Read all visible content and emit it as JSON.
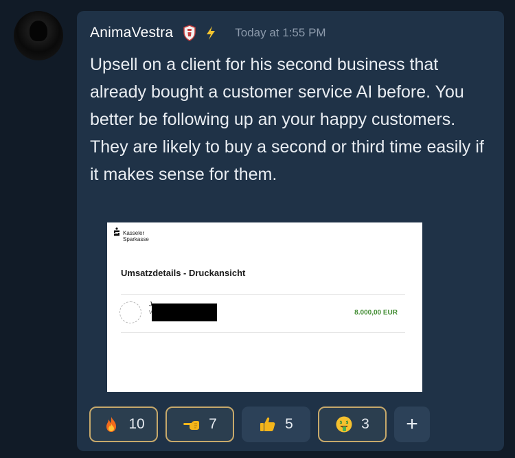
{
  "author": {
    "username": "AnimaVestra",
    "avatar_icon": "statue-avatar",
    "badges": [
      "shield-icon",
      "lightning-icon"
    ]
  },
  "message": {
    "timestamp": "Today at 1:55 PM",
    "text": "Upsell on a client for his second business that already bought a customer service AI before. You better be following up an your happy customers. They are likely to buy a second or third time easily if it makes sense for them."
  },
  "attachment": {
    "bank_name_line1": "Kasseler",
    "bank_name_line2": "Sparkasse",
    "doc_title": "Umsatzdetails - Druckansicht",
    "tx_initial": "J",
    "tx_sub_initial": "V",
    "amount": "8.000,00 EUR"
  },
  "reactions": [
    {
      "emoji": "fire-icon",
      "count": "10",
      "active": true
    },
    {
      "emoji": "pointing-hand-icon",
      "count": "7",
      "active": true
    },
    {
      "emoji": "thumbs-up-icon",
      "count": "5",
      "active": false
    },
    {
      "emoji": "money-mouth-face-icon",
      "count": "3",
      "active": true
    }
  ],
  "add_reaction_label": "+",
  "colors": {
    "background": "#111b27",
    "card": "#1f3247",
    "reaction_active_border": "#c7a96b",
    "amount_green": "#3e8a2e"
  }
}
